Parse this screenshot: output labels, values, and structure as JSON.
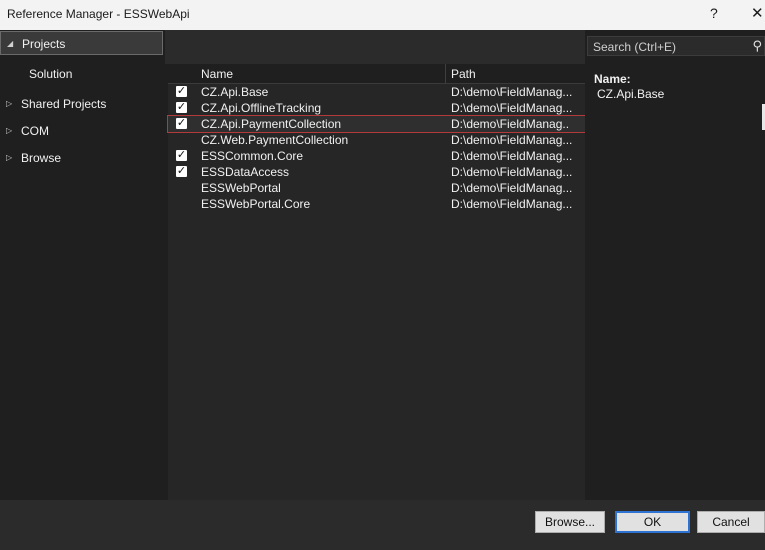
{
  "window": {
    "title": "Reference Manager - ESSWebApi",
    "help": "?",
    "close": "✕"
  },
  "nav": {
    "projects": "Projects",
    "solution": "Solution",
    "shared_projects": "Shared Projects",
    "com": "COM",
    "browse": "Browse"
  },
  "search": {
    "placeholder": "Search (Ctrl+E)"
  },
  "table": {
    "headers": {
      "name": "Name",
      "path": "Path"
    },
    "rows": [
      {
        "checked": true,
        "name": "CZ.Api.Base",
        "path": "D:\\demo\\FieldManag..."
      },
      {
        "checked": true,
        "name": "CZ.Api.OfflineTracking",
        "path": "D:\\demo\\FieldManag..."
      },
      {
        "checked": true,
        "name": "CZ.Api.PaymentCollection",
        "path": "D:\\demo\\FieldManag..."
      },
      {
        "checked": false,
        "name": "CZ.Web.PaymentCollection",
        "path": "D:\\demo\\FieldManag..."
      },
      {
        "checked": true,
        "name": "ESSCommon.Core",
        "path": "D:\\demo\\FieldManag..."
      },
      {
        "checked": true,
        "name": "ESSDataAccess",
        "path": "D:\\demo\\FieldManag..."
      },
      {
        "checked": false,
        "name": "ESSWebPortal",
        "path": "D:\\demo\\FieldManag..."
      },
      {
        "checked": false,
        "name": "ESSWebPortal.Core",
        "path": "D:\\demo\\FieldManag..."
      }
    ]
  },
  "details": {
    "label": "Name:",
    "value": "CZ.Api.Base"
  },
  "buttons": {
    "browse": "Browse...",
    "ok": "OK",
    "cancel": "Cancel"
  },
  "colors": {
    "accent": "#2e73d1",
    "highlight_border": "#b13a3a"
  }
}
